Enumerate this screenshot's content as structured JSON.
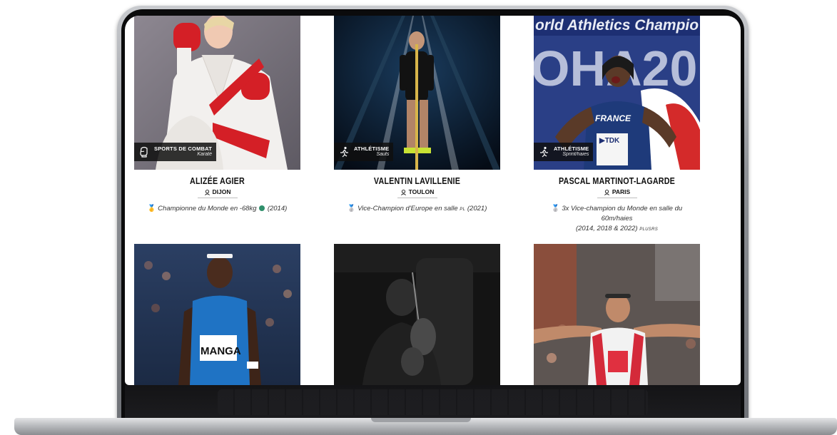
{
  "athletes": [
    {
      "name": "ALIZÉE AGIER",
      "city": "DIJON",
      "sport": "SPORTS DE COMBAT",
      "discipline": "Karaté",
      "sport_icon": "boxing-glove-icon",
      "palmares_line1": "Championne du Monde en -68kg",
      "palmares_line1_suffix": "(2014)",
      "palmares_line2": ""
    },
    {
      "name": "VALENTIN LAVILLENIE",
      "city": "TOULON",
      "sport": "ATHLÉTISME",
      "discipline": "Sauts",
      "sport_icon": "runner-icon",
      "palmares_line1": "Vice-Champion d'Europe en salle",
      "palmares_tag": "PL",
      "palmares_line1_suffix": "(2021)"
    },
    {
      "name": "PASCAL MARTINOT-LAGARDE",
      "city": "PARIS",
      "sport": "ATHLÉTISME",
      "discipline": "Sprint/haies",
      "sport_icon": "runner-icon",
      "palmares_line1": "3x Vice-champion du Monde en salle du 60m/haies",
      "palmares_line2": "(2014, 2018 & 2022)",
      "palmares_more": "PLUSRS"
    }
  ],
  "colors": {
    "badge_bg": "#0f0f0f",
    "text": "#111111",
    "gold_medal": "#e0a526",
    "silver_medal": "#9aa3ad"
  }
}
